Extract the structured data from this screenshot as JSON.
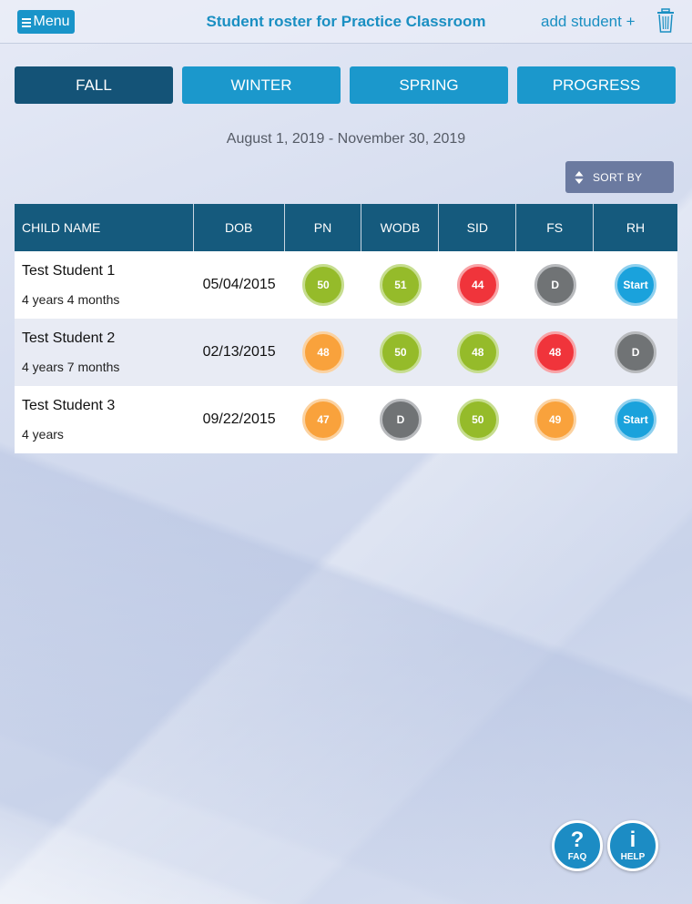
{
  "topbar": {
    "menu_label": "Menu",
    "title": "Student roster for Practice Classroom",
    "add_student_label": "add student +"
  },
  "tabs": [
    {
      "label": "FALL",
      "active": true
    },
    {
      "label": "WINTER",
      "active": false
    },
    {
      "label": "SPRING",
      "active": false
    },
    {
      "label": "PROGRESS",
      "active": false
    }
  ],
  "date_range": "August 1, 2019 - November 30, 2019",
  "sort_label": "SORT BY",
  "table": {
    "headers": [
      "CHILD NAME",
      "DOB",
      "PN",
      "WODB",
      "SID",
      "FS",
      "RH"
    ],
    "rows": [
      {
        "name": "Test Student 1",
        "age": "4 years 4 months",
        "dob": "05/04/2015",
        "scores": [
          {
            "text": "50",
            "status": "green"
          },
          {
            "text": "51",
            "status": "green"
          },
          {
            "text": "44",
            "status": "red"
          },
          {
            "text": "D",
            "status": "gray"
          },
          {
            "text": "Start",
            "status": "blue"
          }
        ]
      },
      {
        "name": "Test Student 2",
        "age": "4 years 7 months",
        "dob": "02/13/2015",
        "scores": [
          {
            "text": "48",
            "status": "orange"
          },
          {
            "text": "50",
            "status": "green"
          },
          {
            "text": "48",
            "status": "green"
          },
          {
            "text": "48",
            "status": "red"
          },
          {
            "text": "D",
            "status": "gray"
          }
        ]
      },
      {
        "name": "Test Student 3",
        "age": "4 years",
        "dob": "09/22/2015",
        "scores": [
          {
            "text": "47",
            "status": "orange"
          },
          {
            "text": "D",
            "status": "gray"
          },
          {
            "text": "50",
            "status": "green"
          },
          {
            "text": "49",
            "status": "orange"
          },
          {
            "text": "Start",
            "status": "blue"
          }
        ]
      }
    ]
  },
  "fabs": {
    "faq_glyph": "?",
    "faq_label": "FAQ",
    "help_glyph": "i",
    "help_label": "HELP"
  },
  "colors": {
    "accent": "#1a8fc2",
    "tab_active": "#145377",
    "tab_inactive": "#1b98cc",
    "header_bg": "#155a7d",
    "green": "#95bb2a",
    "red": "#f0343b",
    "orange": "#f9a23c",
    "gray": "#707375",
    "blue": "#1aa2dc"
  }
}
